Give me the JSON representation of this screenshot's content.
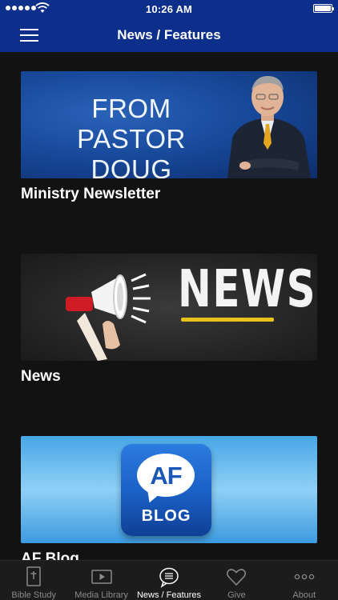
{
  "status_bar": {
    "time": "10:26 AM"
  },
  "nav": {
    "title": "News / Features"
  },
  "feed": {
    "items": [
      {
        "caption": "Ministry Newsletter",
        "banner_text_line1": "FROM",
        "banner_text_line2": "PASTOR DOUG"
      },
      {
        "caption": "News",
        "banner_text": "NEWS"
      },
      {
        "caption": "AF Blog",
        "logo_text_top": "AF",
        "logo_text_bottom": "BLOG"
      }
    ]
  },
  "tabbar": {
    "tabs": [
      {
        "label": "Bible Study",
        "icon": "bible-icon",
        "active": false
      },
      {
        "label": "Media Library",
        "icon": "play-icon",
        "active": false
      },
      {
        "label": "News / Features",
        "icon": "chat-bubble-icon",
        "active": true
      },
      {
        "label": "Give",
        "icon": "heart-icon",
        "active": false
      },
      {
        "label": "About",
        "icon": "more-icon",
        "active": false
      }
    ]
  },
  "colors": {
    "nav_background": "#0d2f8c",
    "background": "#121212",
    "tabbar_background": "#1c1c1c",
    "news_underline": "#e8c21b"
  }
}
